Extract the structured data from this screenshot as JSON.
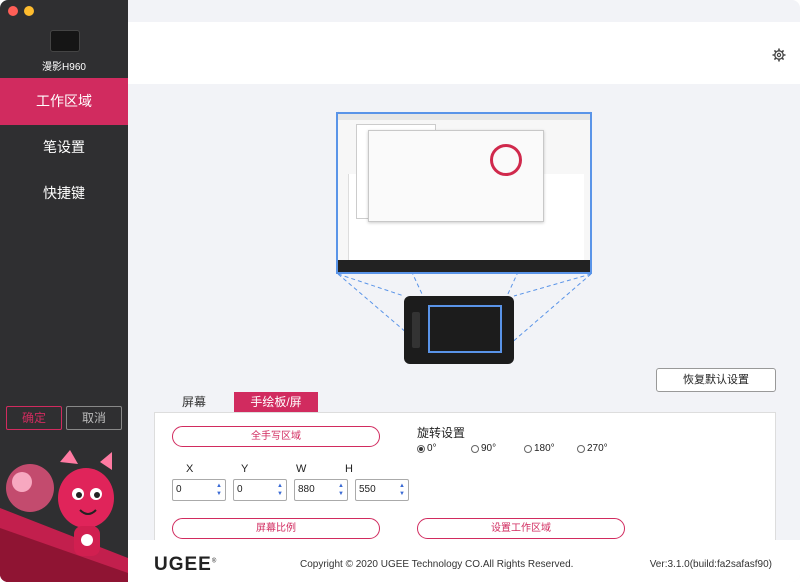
{
  "sidebar": {
    "device_name": "漫影H960",
    "items": [
      {
        "label": "工作区域",
        "active": true
      },
      {
        "label": "笔设置",
        "active": false
      },
      {
        "label": "快捷键",
        "active": false
      }
    ],
    "confirm_label": "确定",
    "cancel_label": "取消"
  },
  "topbar": {
    "settings_icon": "gear-icon"
  },
  "main": {
    "restore_label": "恢复默认设置",
    "tabs": [
      {
        "label": "屏幕",
        "active": false
      },
      {
        "label": "手绘板/屏",
        "active": true
      }
    ],
    "full_area_label": "全手写区域",
    "screen_ratio_label": "屏幕比例",
    "set_area_label": "设置工作区域",
    "rotation": {
      "title": "旋转设置",
      "options": [
        "0°",
        "90°",
        "180°",
        "270°"
      ],
      "selected": "0°"
    },
    "coords": {
      "x_label": "X",
      "x_value": "0",
      "y_label": "Y",
      "y_value": "0",
      "w_label": "W",
      "w_value": "880",
      "h_label": "H",
      "h_value": "550"
    }
  },
  "footer": {
    "brand": "UGEE",
    "brand_mark": "®",
    "copyright": "Copyright © 2020 UGEE Technology CO.All Rights Reserved.",
    "version": "Ver:3.1.0(build:fa2safasf90)"
  },
  "colors": {
    "accent": "#d12b5f",
    "sidebar": "#2f2f31",
    "mapping_line": "#5a94e8"
  }
}
